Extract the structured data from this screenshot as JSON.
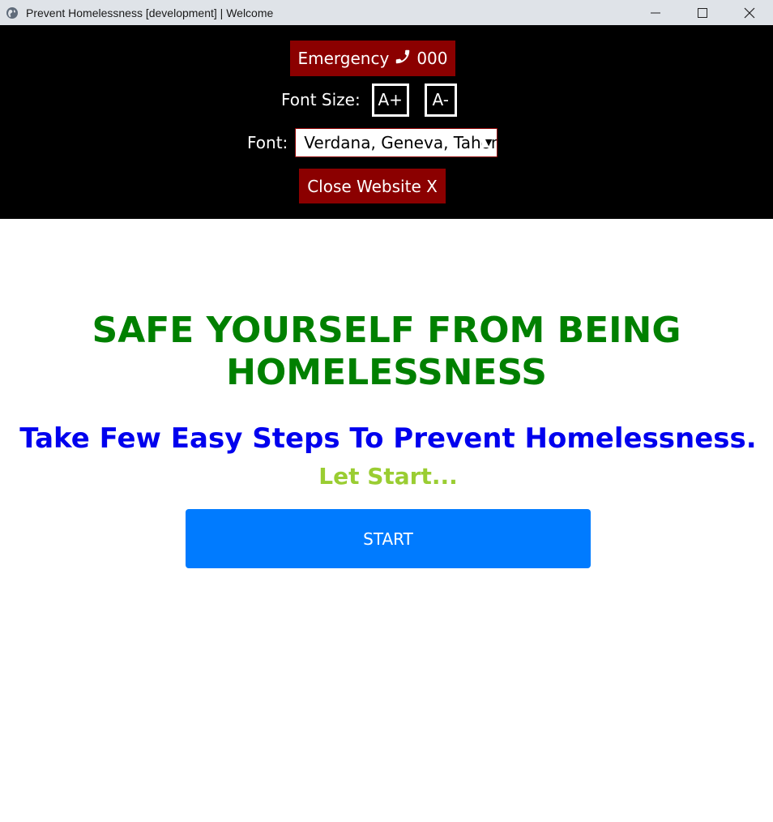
{
  "window": {
    "title": "Prevent Homelessness [development] | Welcome",
    "icon": "globe-icon",
    "controls": [
      "minimize-icon",
      "maximize-icon",
      "close-icon"
    ]
  },
  "topbar": {
    "emergency_label": "Emergency",
    "emergency_icon": "phone-icon",
    "emergency_number": "000",
    "font_size_label": "Font Size:",
    "increase_label": "A+",
    "decrease_label": "A-",
    "font_label": "Font:",
    "font_selected": "Verdana, Geneva, Tahoma, sans-serif",
    "close_label": "Close Website X"
  },
  "main": {
    "headline": "SAFE YOURSELF FROM BEING HOMELESSNESS",
    "subheadline": "Take Few Easy Steps To Prevent Homelessness.",
    "prompt": "Let Start...",
    "start_label": "START"
  },
  "colors": {
    "topbar_bg": "#000000",
    "emergency_bg": "#8b0000",
    "headline": "#008000",
    "subheadline": "#0000ee",
    "prompt": "#9acd32",
    "start_bg": "#007bff"
  }
}
